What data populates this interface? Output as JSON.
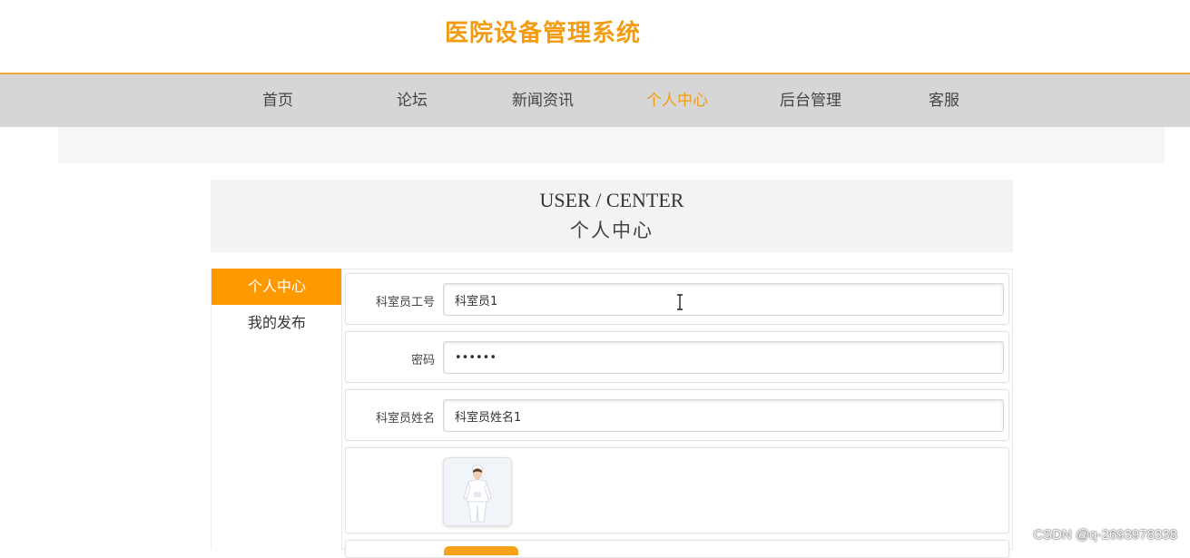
{
  "site": {
    "title": "医院设备管理系统"
  },
  "nav": {
    "items": [
      {
        "label": "首页"
      },
      {
        "label": "论坛"
      },
      {
        "label": "新闻资讯"
      },
      {
        "label": "个人中心",
        "active": true
      },
      {
        "label": "后台管理"
      },
      {
        "label": "客服"
      }
    ]
  },
  "header": {
    "en": "USER / CENTER",
    "cn": "个人中心"
  },
  "sidebar": {
    "items": [
      {
        "label": "个人中心",
        "active": true
      },
      {
        "label": "我的发布"
      }
    ]
  },
  "form": {
    "staff_id": {
      "label": "科室员工号",
      "value": "科室员1"
    },
    "password": {
      "label": "密码",
      "value": "••••••"
    },
    "staff_name": {
      "label": "科室员姓名",
      "value": "科室员姓名1"
    },
    "avatar": {
      "label": "",
      "icon": "nurse-photo"
    }
  },
  "watermark": "CSDN @q-2693978338",
  "colors": {
    "accent": "#ff9900",
    "nav_bg": "#d6d6d6",
    "title": "#f39c12"
  }
}
